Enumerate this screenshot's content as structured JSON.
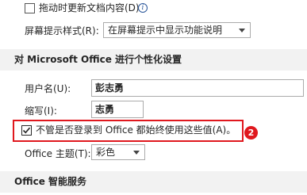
{
  "options": {
    "drag_update": {
      "label": "拖动时更新文档内容(D)",
      "checked": false
    },
    "screentip": {
      "label": "屏幕提示样式(R):",
      "value": "在屏幕提示中显示功能说明"
    }
  },
  "personalize": {
    "section_title": "对 Microsoft Office 进行个性化设置",
    "username_label": "用户名(U):",
    "username_value": "彭志勇",
    "initials_label": "缩写(I):",
    "initials_value": "志勇",
    "always_use": {
      "label": "不管是否登录到 Office 都始终使用这些值(A)。",
      "checked": true
    },
    "theme_label": "Office 主题(T):",
    "theme_value": "彩色",
    "callout_number": "2"
  },
  "intelligent_services": {
    "section_title": "Office 智能服务"
  },
  "colors": {
    "highlight": "#e0181e",
    "section_bg": "#f2f2f2"
  },
  "icons": {
    "info": "info-icon",
    "dropdown": "chevron-down-icon",
    "check": "checkmark-icon"
  }
}
